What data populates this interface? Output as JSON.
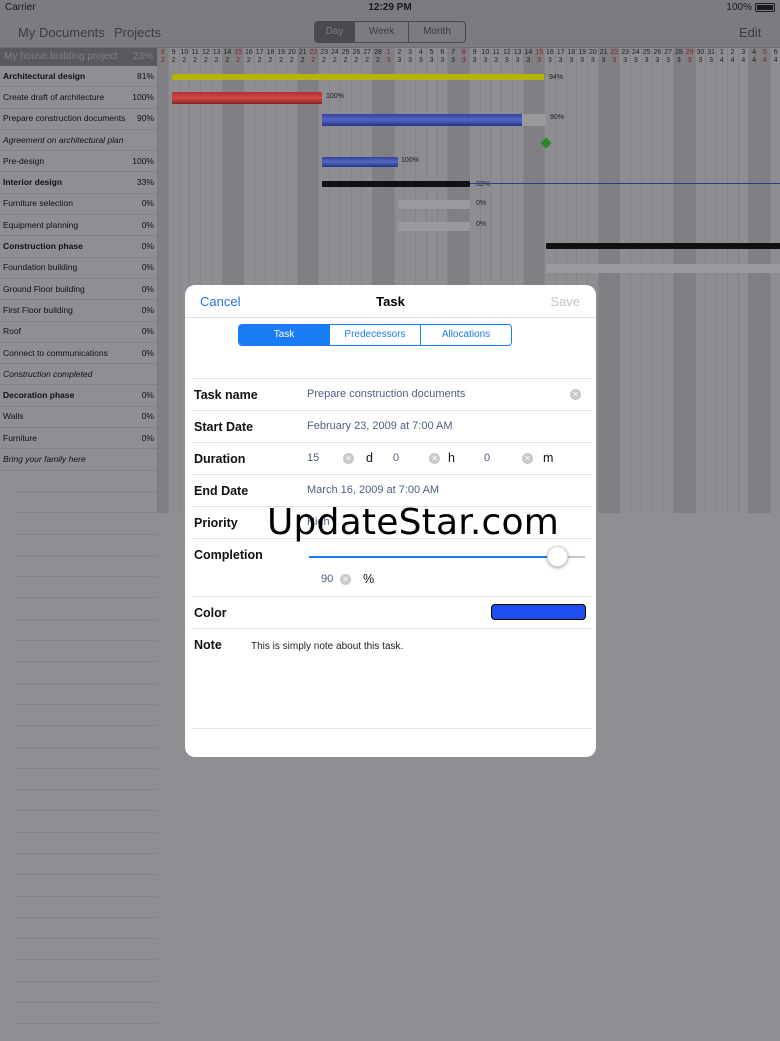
{
  "status": {
    "carrier": "Carrier",
    "time": "12:29 PM",
    "battery": "100%"
  },
  "nav": {
    "my_documents": "My Documents",
    "projects": "Projects",
    "view_tabs": [
      "Day",
      "Week",
      "Month"
    ],
    "active_view": "Day",
    "edit": "Edit"
  },
  "project": {
    "name": "My house building project",
    "completion": "23%"
  },
  "tasks": [
    {
      "name": "Architectural design",
      "pct": "81%",
      "style": "bold"
    },
    {
      "name": "Create draft of architecture",
      "pct": "100%",
      "style": ""
    },
    {
      "name": "Prepare construction documents",
      "pct": "90%",
      "style": ""
    },
    {
      "name": "Agreement on architectural plan",
      "pct": "",
      "style": "ital"
    },
    {
      "name": "Pre-design",
      "pct": "100%",
      "style": ""
    },
    {
      "name": "Interior design",
      "pct": "33%",
      "style": "bold"
    },
    {
      "name": "Furniture selection",
      "pct": "0%",
      "style": ""
    },
    {
      "name": "Equipment planning",
      "pct": "0%",
      "style": ""
    },
    {
      "name": "Construction phase",
      "pct": "0%",
      "style": "bold"
    },
    {
      "name": "Foundation building",
      "pct": "0%",
      "style": ""
    },
    {
      "name": "Ground Floor building",
      "pct": "0%",
      "style": ""
    },
    {
      "name": "First Floor building",
      "pct": "0%",
      "style": ""
    },
    {
      "name": "Roof",
      "pct": "0%",
      "style": ""
    },
    {
      "name": "Connect to communications",
      "pct": "0%",
      "style": ""
    },
    {
      "name": "Construction completed",
      "pct": "",
      "style": "ital"
    },
    {
      "name": "Decoration phase",
      "pct": "0%",
      "style": "bold"
    },
    {
      "name": "Walls",
      "pct": "0%",
      "style": ""
    },
    {
      "name": "Furniture",
      "pct": "0%",
      "style": ""
    },
    {
      "name": "Bring your family here",
      "pct": "",
      "style": "ital"
    }
  ],
  "gantt_days": [
    {
      "top": "8",
      "bot": "2",
      "red": true
    },
    {
      "top": "9",
      "bot": "2"
    },
    {
      "top": "10",
      "bot": "2"
    },
    {
      "top": "11",
      "bot": "2"
    },
    {
      "top": "12",
      "bot": "2"
    },
    {
      "top": "13",
      "bot": "2"
    },
    {
      "top": "14",
      "bot": "2"
    },
    {
      "top": "15",
      "bot": "2",
      "red": true
    },
    {
      "top": "16",
      "bot": "2"
    },
    {
      "top": "17",
      "bot": "2"
    },
    {
      "top": "18",
      "bot": "2"
    },
    {
      "top": "19",
      "bot": "2"
    },
    {
      "top": "20",
      "bot": "2"
    },
    {
      "top": "21",
      "bot": "2"
    },
    {
      "top": "22",
      "bot": "2",
      "red": true
    },
    {
      "top": "23",
      "bot": "2"
    },
    {
      "top": "24",
      "bot": "2"
    },
    {
      "top": "25",
      "bot": "2"
    },
    {
      "top": "26",
      "bot": "2"
    },
    {
      "top": "27",
      "bot": "2"
    },
    {
      "top": "28",
      "bot": "2"
    },
    {
      "top": "1",
      "bot": "3",
      "red": true
    },
    {
      "top": "2",
      "bot": "3"
    },
    {
      "top": "3",
      "bot": "3"
    },
    {
      "top": "4",
      "bot": "3"
    },
    {
      "top": "5",
      "bot": "3"
    },
    {
      "top": "6",
      "bot": "3"
    },
    {
      "top": "7",
      "bot": "3"
    },
    {
      "top": "8",
      "bot": "3",
      "red": true
    },
    {
      "top": "9",
      "bot": "3"
    },
    {
      "top": "10",
      "bot": "3"
    },
    {
      "top": "11",
      "bot": "3"
    },
    {
      "top": "12",
      "bot": "3"
    },
    {
      "top": "13",
      "bot": "3"
    },
    {
      "top": "14",
      "bot": "3"
    },
    {
      "top": "15",
      "bot": "3",
      "red": true
    },
    {
      "top": "16",
      "bot": "3"
    },
    {
      "top": "17",
      "bot": "3"
    },
    {
      "top": "18",
      "bot": "3"
    },
    {
      "top": "19",
      "bot": "3"
    },
    {
      "top": "20",
      "bot": "3"
    },
    {
      "top": "21",
      "bot": "3"
    },
    {
      "top": "22",
      "bot": "3",
      "red": true
    },
    {
      "top": "23",
      "bot": "3"
    },
    {
      "top": "24",
      "bot": "3"
    },
    {
      "top": "25",
      "bot": "3"
    },
    {
      "top": "26",
      "bot": "3"
    },
    {
      "top": "27",
      "bot": "3"
    },
    {
      "top": "28",
      "bot": "3"
    },
    {
      "top": "29",
      "bot": "3",
      "red": true
    },
    {
      "top": "30",
      "bot": "3"
    },
    {
      "top": "31",
      "bot": "3"
    },
    {
      "top": "1",
      "bot": "4"
    },
    {
      "top": "2",
      "bot": "4"
    },
    {
      "top": "3",
      "bot": "4"
    },
    {
      "top": "4",
      "bot": "4"
    },
    {
      "top": "5",
      "bot": "4",
      "red": true
    },
    {
      "top": "6",
      "bot": "4"
    }
  ],
  "gantt_labels": [
    "94%",
    "100%",
    "90%",
    "100%",
    "33%",
    "0%",
    "0%"
  ],
  "dialog": {
    "cancel": "Cancel",
    "title": "Task",
    "save": "Save",
    "tabs": [
      "Task",
      "Predecessors",
      "Allocations"
    ],
    "active_tab": "Task",
    "task_name_label": "Task name",
    "task_name_value": "Prepare construction documents",
    "start_date_label": "Start Date",
    "start_date_value": "February 23, 2009 at 7:00 AM",
    "duration_label": "Duration",
    "duration_days": "15",
    "duration_days_unit": "d",
    "duration_hours": "0",
    "duration_hours_unit": "h",
    "duration_minutes": "0",
    "duration_minutes_unit": "m",
    "end_date_label": "End Date",
    "end_date_value": "March 16, 2009 at 7:00 AM",
    "priority_label": "Priority",
    "priority_value": "High",
    "completion_label": "Completion",
    "completion_value": "90",
    "completion_unit": "%",
    "completion_fraction": 0.9,
    "color_label": "Color",
    "color_value": "#1e4ef0",
    "note_label": "Note",
    "note_value": "This is simply note about this task."
  },
  "watermark": "UpdateStar.com"
}
